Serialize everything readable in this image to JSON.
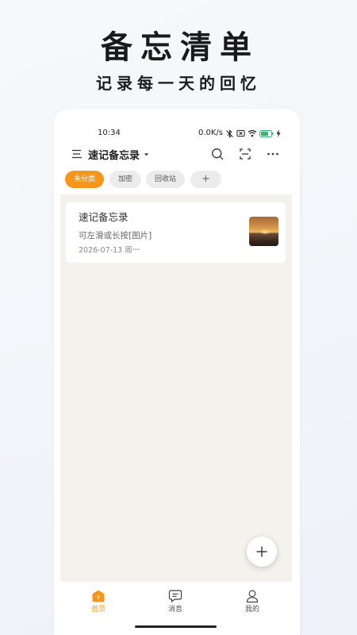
{
  "hero": {
    "title": "备忘清单",
    "subtitle": "记录每一天的回忆"
  },
  "status_bar": {
    "time": "10:34",
    "net_speed": "0.0K/s",
    "icons": [
      "bluetooth-icon",
      "sim-off-icon",
      "wifi-icon",
      "battery-icon",
      "charging-icon"
    ]
  },
  "header": {
    "title": "速记备忘录",
    "icons": [
      "menu-icon",
      "chevron-down-icon",
      "search-icon",
      "scan-icon",
      "more-icon"
    ]
  },
  "categories": [
    {
      "label": "未分类",
      "active": true
    },
    {
      "label": "加密",
      "active": false
    },
    {
      "label": "回收站",
      "active": false
    },
    {
      "label": "+",
      "active": false
    }
  ],
  "notes": [
    {
      "title": "速记备忘录",
      "preview": "可左滑或长按[图片]",
      "date": "2026-07-13 周一",
      "thumbnail": "sunset-over-sea-photo"
    }
  ],
  "fab": {
    "icon": "plus-icon"
  },
  "bottom_nav": [
    {
      "label": "首页",
      "icon": "home-icon",
      "active": true
    },
    {
      "label": "消息",
      "icon": "message-icon",
      "active": false
    },
    {
      "label": "我的",
      "icon": "profile-icon",
      "active": false
    }
  ],
  "colors": {
    "accent": "#f5961f",
    "content_background": "#f3f2ed",
    "chip_background": "#ececec",
    "battery": "#3cb371"
  }
}
